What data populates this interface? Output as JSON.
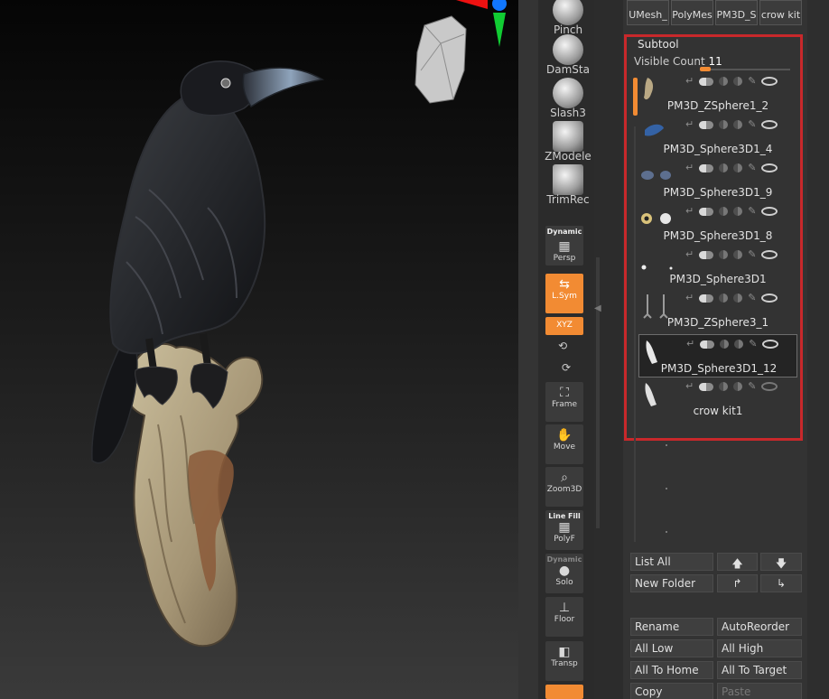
{
  "shelf": {
    "brushes": [
      {
        "label": "Pinch",
        "icon": "pinch-brush-icon"
      },
      {
        "label": "DamSta",
        "icon": "damstandard-brush-icon"
      },
      {
        "label": "Slash3",
        "icon": "slash3-brush-icon"
      },
      {
        "label": "ZModele",
        "icon": "zmodeler-brush-icon"
      },
      {
        "label": "TrimRec",
        "icon": "trimrect-brush-icon"
      }
    ],
    "persp": {
      "top": "Dynamic",
      "label": "Persp"
    },
    "lsym": {
      "label": "L.Sym"
    },
    "xyz": {
      "label": "XYZ"
    },
    "frame": {
      "label": "Frame"
    },
    "move": {
      "label": "Move"
    },
    "zoom3d": {
      "label": "Zoom3D"
    },
    "polyf": {
      "top": "Line Fill",
      "label": "PolyF"
    },
    "solo": {
      "top": "Dynamic",
      "label": "Solo"
    },
    "floor": {
      "label": "Floor"
    },
    "transp": {
      "label": "Transp"
    }
  },
  "palette": {
    "thumbs": [
      "UMesh_",
      "PolyMes",
      "PM3D_S",
      "crow kit"
    ],
    "subtool_title": "Subtool",
    "visible_count_label": "Visible Count",
    "visible_count_value": "11",
    "subtools": [
      {
        "name": "PM3D_ZSphere1_2"
      },
      {
        "name": "PM3D_Sphere3D1_4"
      },
      {
        "name": "PM3D_Sphere3D1_9"
      },
      {
        "name": "PM3D_Sphere3D1_8"
      },
      {
        "name": "PM3D_Sphere3D1"
      },
      {
        "name": "PM3D_ZSphere3_1"
      },
      {
        "name": "PM3D_Sphere3D1_12"
      },
      {
        "name": "crow kit1"
      }
    ],
    "buttons": {
      "list_all": "List All",
      "new_folder": "New Folder",
      "rename": "Rename",
      "auto_reorder": "AutoReorder",
      "all_low": "All Low",
      "all_high": "All High",
      "all_to_home": "All To Home",
      "all_to_target": "All To Target",
      "copy": "Copy",
      "paste": "Paste"
    },
    "arrows": {
      "up": "🡅",
      "down": "🡇",
      "move_right": "↱",
      "move_down": "↳"
    }
  },
  "colors": {
    "accent": "#f28b33",
    "highlight_frame": "#c8282b"
  }
}
